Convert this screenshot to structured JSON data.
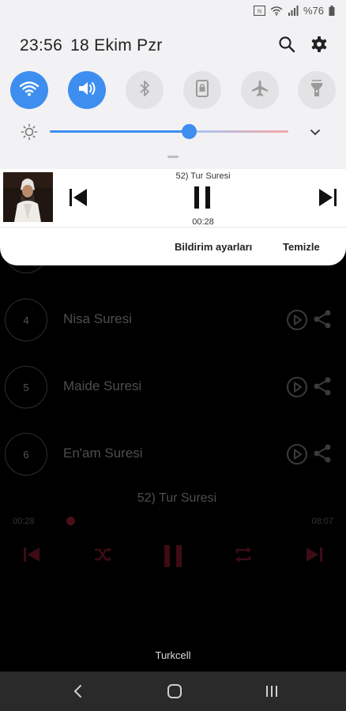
{
  "status_bar": {
    "battery_text": "%76",
    "icons": [
      "nfc-icon",
      "wifi-signal-icon",
      "cellular-signal-icon",
      "battery-icon"
    ]
  },
  "quick_panel": {
    "time": "23:56",
    "date": "18 Ekim Pzr",
    "top_icons": [
      "search-icon",
      "gear-icon"
    ],
    "toggles": [
      {
        "name": "wifi",
        "icon": "wifi-icon",
        "on": true
      },
      {
        "name": "sound",
        "icon": "volume-icon",
        "on": true
      },
      {
        "name": "bluetooth",
        "icon": "bluetooth-icon",
        "on": false
      },
      {
        "name": "screen-rotation",
        "icon": "portrait-lock-icon",
        "on": false
      },
      {
        "name": "airplane-mode",
        "icon": "airplane-icon",
        "on": false
      },
      {
        "name": "flashlight",
        "icon": "flashlight-icon",
        "on": false
      }
    ],
    "brightness_level": 0.58,
    "accent_color": "#3e8ef0"
  },
  "media_notification": {
    "title": "52) Tur Suresi",
    "elapsed": "00:28",
    "controls": [
      "previous-icon",
      "pause-icon",
      "next-icon"
    ],
    "actions": {
      "settings": "Bildirim ayarları",
      "clear": "Temizle"
    }
  },
  "app": {
    "tracks": [
      {
        "number": "4",
        "name": "Nisa Suresi"
      },
      {
        "number": "5",
        "name": "Maide Suresi"
      },
      {
        "number": "6",
        "name": "En'am Suresi"
      }
    ],
    "player": {
      "now_playing": "52) Tur Suresi",
      "elapsed": "00:28",
      "duration": "08:07",
      "progress": 0.058,
      "accent_color": "#4a0e19"
    }
  },
  "carrier": "Turkcell",
  "nav_bar": {
    "buttons": [
      "back-icon",
      "home-icon",
      "recents-icon"
    ]
  }
}
